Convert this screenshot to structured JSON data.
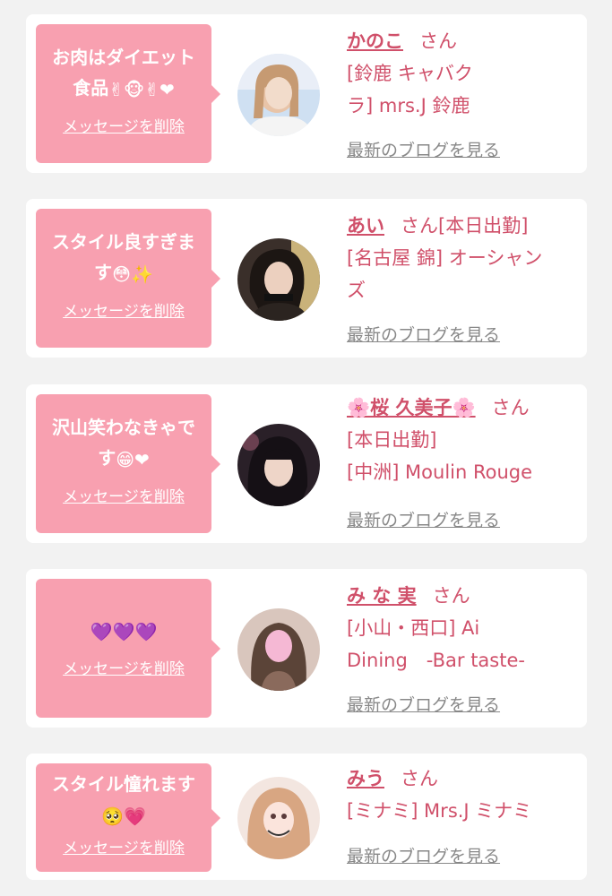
{
  "colors": {
    "accent": "#d0506a",
    "bubble": "#f8a0b0",
    "background": "#f2f2f2"
  },
  "delete_label": "メッセージを削除",
  "blog_label": "最新のブログを見る",
  "cards": [
    {
      "message_line1": "お肉はダイエット",
      "message_line2": "食品",
      "message_emoji": "✌🐵✌❤",
      "name": "かのこ",
      "suffix": "さん",
      "shop_line1": "[鈴鹿 キャバク",
      "shop_line2": "ラ] mrs.J 鈴鹿"
    },
    {
      "message_line1": "スタイル良すぎま",
      "message_line2": "す",
      "message_emoji": "😳✨",
      "name": "あい",
      "suffix": "さん[本日出勤]",
      "shop_line1": "[名古屋 錦] オーシャン",
      "shop_line2": "ズ"
    },
    {
      "message_line1": "沢山笑わなきゃで",
      "message_line2": "す",
      "message_emoji": "😁❤",
      "name": "🌸桜 久美子🌸",
      "suffix": "さん",
      "shop_line1": "[本日出勤]",
      "shop_line2": "[中洲] Moulin Rouge"
    },
    {
      "message_line1": "",
      "message_line2": "",
      "message_emoji": "💜💜💜",
      "name": "み な 実",
      "suffix": "さん",
      "shop_line1": "[小山・西口] Ai",
      "shop_line2": "Dining　-Bar taste-"
    },
    {
      "message_line1": "スタイル憧れます",
      "message_line2": "",
      "message_emoji": "🥺💗",
      "name": "みう",
      "suffix": "さん",
      "shop_line1": "[ミナミ] Mrs.J ミナミ",
      "shop_line2": ""
    }
  ]
}
